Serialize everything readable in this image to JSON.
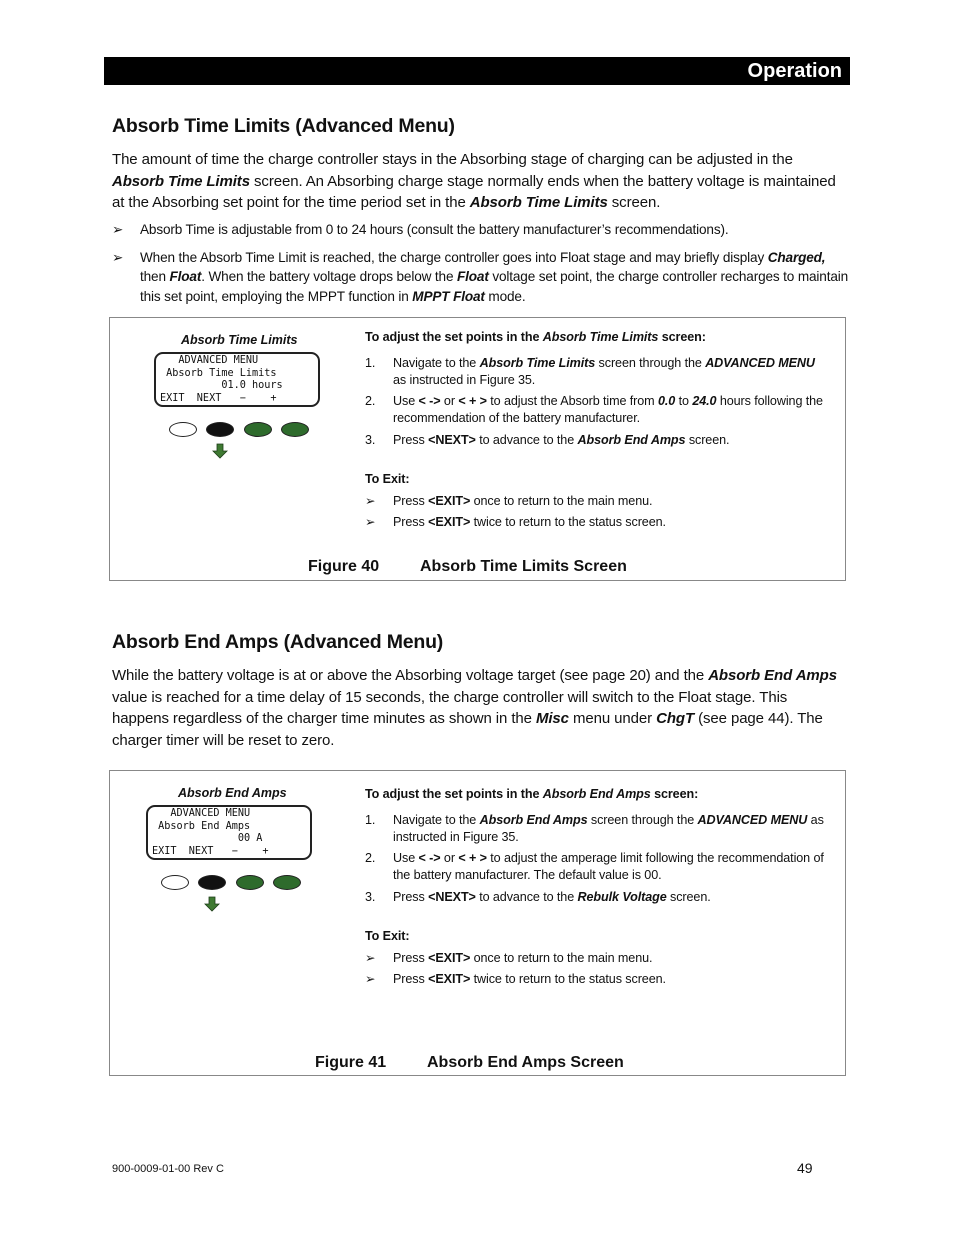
{
  "header": {
    "section": "Operation"
  },
  "section1": {
    "title": "Absorb Time Limits (Advanced Menu)",
    "intro": [
      {
        "t": "The amount of time the charge controller stays in the Absorbing stage of charging can be adjusted in the "
      },
      {
        "t": "Absorb Time Limits",
        "bi": true
      },
      {
        "t": " screen.  An Absorbing charge stage normally ends when the battery voltage is maintained at the Absorbing set point for the time period set in the "
      },
      {
        "t": "Absorb Time Limits",
        "bi": true
      },
      {
        "t": " screen."
      }
    ],
    "bullets": [
      [
        {
          "t": "Absorb Time is adjustable from 0 to 24 hours (consult the battery manufacturer’s recommendations)."
        }
      ],
      [
        {
          "t": "When the Absorb Time Limit is reached, the charge controller goes into Float stage and may briefly display "
        },
        {
          "t": "Charged,",
          "bi": true
        },
        {
          "t": " then "
        },
        {
          "t": "Float",
          "bi": true
        },
        {
          "t": ".  When the battery voltage drops below the "
        },
        {
          "t": "Float",
          "bi": true
        },
        {
          "t": " voltage set point, the charge controller recharges to maintain this set point, employing the MPPT function in "
        },
        {
          "t": "MPPT Float",
          "bi": true
        },
        {
          "t": " mode."
        }
      ]
    ],
    "figure": {
      "lcd_caption": "Absorb Time Limits",
      "lcd_lines": [
        "   ADVANCED MENU",
        " Absorb Time Limits",
        "          01.0 hours",
        "EXIT  NEXT   −    +"
      ],
      "instructions_heading": [
        {
          "t": "To adjust the set points in the ",
          "b": true
        },
        {
          "t": "Absorb Time Limits",
          "i": true
        },
        {
          "t": " screen:",
          "b": true
        }
      ],
      "steps": [
        {
          "num": "1.",
          "parts": [
            {
              "t": "Navigate to the "
            },
            {
              "t": "Absorb Time Limits",
              "bi": true
            },
            {
              "t": " screen through the "
            },
            {
              "t": "ADVANCED MENU",
              "bi": true
            },
            {
              "t": " as instructed in Figure 35."
            }
          ]
        },
        {
          "num": "2.",
          "parts": [
            {
              "t": "Use "
            },
            {
              "t": "< ->",
              "b": true
            },
            {
              "t": " or "
            },
            {
              "t": "< + >",
              "b": true
            },
            {
              "t": " to adjust the Absorb time from "
            },
            {
              "t": "0.0",
              "bi": true
            },
            {
              "t": " to "
            },
            {
              "t": "24.0",
              "bi": true
            },
            {
              "t": " hours following the recommendation of the battery manufacturer."
            }
          ]
        },
        {
          "num": "3.",
          "parts": [
            {
              "t": "Press "
            },
            {
              "t": "<NEXT>",
              "b": true
            },
            {
              "t": " to advance to the "
            },
            {
              "t": "Absorb End Amps",
              "bi": true
            },
            {
              "t": " screen."
            }
          ]
        }
      ],
      "exit_heading": "To Exit:",
      "exit_steps": [
        [
          {
            "t": "Press "
          },
          {
            "t": "<EXIT>",
            "b": true
          },
          {
            "t": " once to return to the main menu."
          }
        ],
        [
          {
            "t": "Press "
          },
          {
            "t": "<EXIT>",
            "b": true
          },
          {
            "t": " twice to return to the status screen."
          }
        ]
      ],
      "caption_label": "Figure 40",
      "caption_title": "Absorb Time Limits Screen"
    }
  },
  "section2": {
    "title": "Absorb End Amps (Advanced Menu)",
    "intro": [
      {
        "t": "While the battery voltage is at or above the Absorbing voltage target (see page 20) and the "
      },
      {
        "t": "Absorb End Amps",
        "bi": true
      },
      {
        "t": " value is reached for a time delay of 15 seconds, the charge controller will switch to the Float stage.  This happens regardless of the charger time minutes as shown in the "
      },
      {
        "t": "Misc",
        "bi": true
      },
      {
        "t": " menu under "
      },
      {
        "t": "ChgT",
        "bi": true
      },
      {
        "t": " (see page 44).  The charger timer will be reset to zero."
      }
    ],
    "figure": {
      "lcd_caption": "Absorb End Amps",
      "lcd_lines": [
        "   ADVANCED MENU",
        " Absorb End Amps",
        "              00 A",
        "EXIT  NEXT   −    +"
      ],
      "instructions_heading": [
        {
          "t": "To adjust the set points in the ",
          "b": true
        },
        {
          "t": "Absorb End Amps",
          "i": true
        },
        {
          "t": " screen:",
          "b": true
        }
      ],
      "steps": [
        {
          "num": "1.",
          "parts": [
            {
              "t": "Navigate to the "
            },
            {
              "t": "Absorb End Amps",
              "bi": true
            },
            {
              "t": " screen through the "
            },
            {
              "t": "ADVANCED MENU",
              "bi": true
            },
            {
              "t": " as instructed in Figure 35."
            }
          ]
        },
        {
          "num": "2.",
          "parts": [
            {
              "t": "Use "
            },
            {
              "t": "< ->",
              "b": true
            },
            {
              "t": " or "
            },
            {
              "t": "< + >",
              "b": true
            },
            {
              "t": " to adjust the amperage limit  following the recommendation of the battery manufacturer.  The default value is 00."
            }
          ]
        },
        {
          "num": "3.",
          "parts": [
            {
              "t": "Press "
            },
            {
              "t": "<NEXT>",
              "b": true
            },
            {
              "t": " to advance to the "
            },
            {
              "t": "Rebulk Voltage",
              "bi": true
            },
            {
              "t": " screen."
            }
          ]
        }
      ],
      "exit_heading": "To Exit:",
      "exit_steps": [
        [
          {
            "t": "Press "
          },
          {
            "t": "<EXIT>",
            "b": true
          },
          {
            "t": " once to return to the main menu."
          }
        ],
        [
          {
            "t": "Press "
          },
          {
            "t": "<EXIT>",
            "b": true
          },
          {
            "t": " twice to return to the status screen."
          }
        ]
      ],
      "caption_label": "Figure 41",
      "caption_title": "Absorb End Amps Screen"
    }
  },
  "footer": {
    "doc_number": "900-0009-01-00 Rev C",
    "page_number": "49"
  },
  "colors": {
    "button_green": "#2e6b2c",
    "header_bg": "#000000"
  },
  "icons": {
    "bullet": "➢",
    "arrow": "down-arrow-icon"
  }
}
